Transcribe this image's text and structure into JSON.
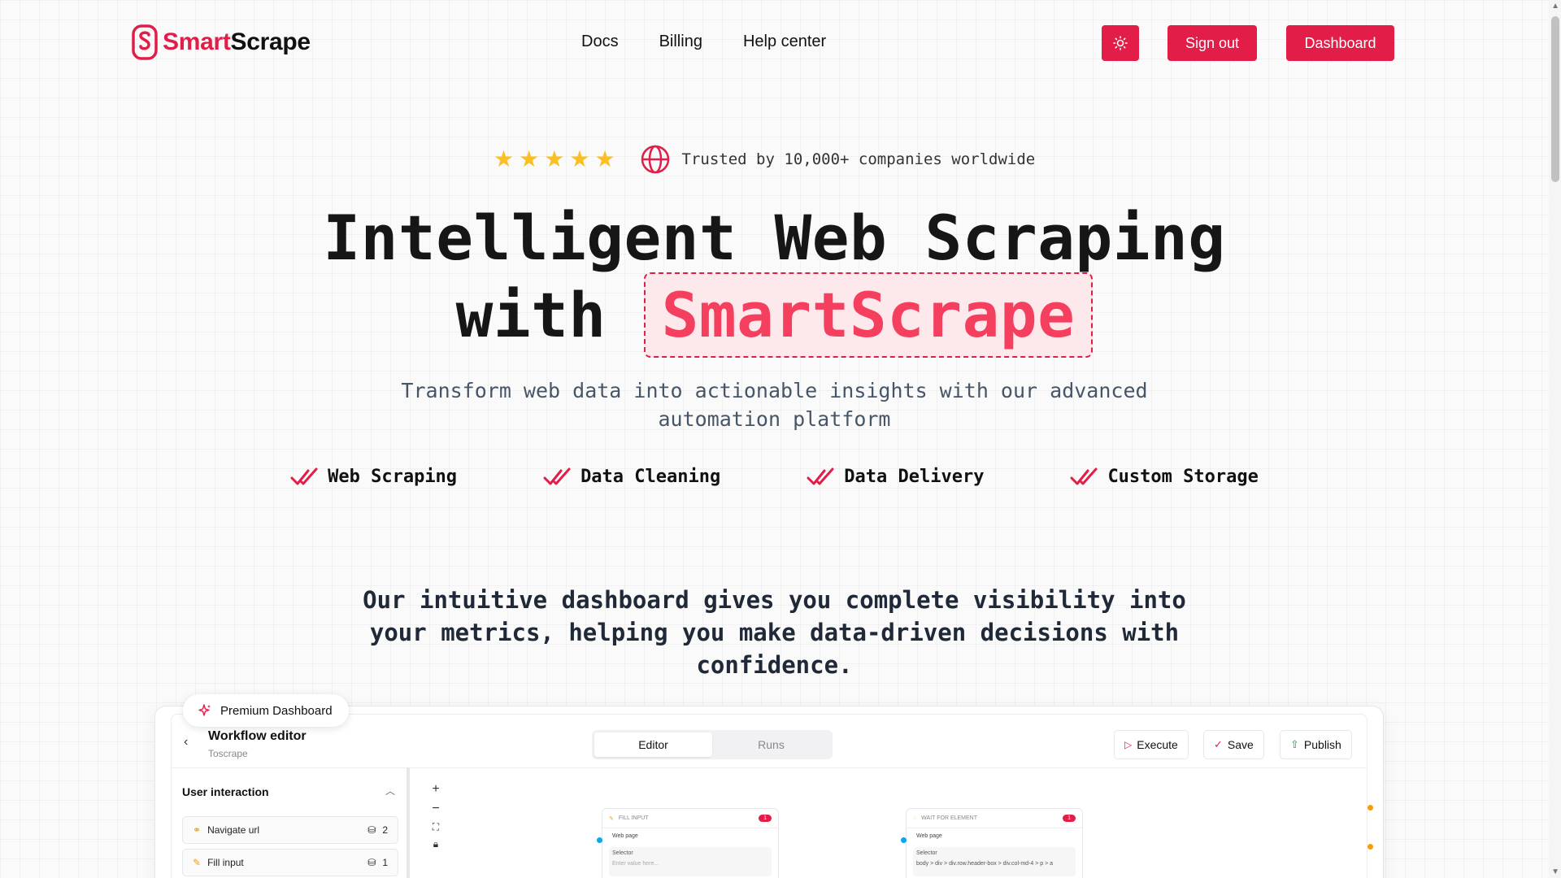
{
  "brand": {
    "name_part1": "Smart",
    "name_part2": "Scrape",
    "accent": "#e11d48"
  },
  "nav": {
    "links": [
      "Docs",
      "Billing",
      "Help center"
    ],
    "theme_icon": "sun-icon",
    "sign_out": "Sign out",
    "dashboard": "Dashboard"
  },
  "trust": {
    "stars": 5,
    "text": "Trusted by 10,000+ companies worldwide"
  },
  "hero": {
    "line1": "Intelligent Web Scraping",
    "line2_prefix": "with",
    "highlight": "SmartScrape",
    "subtitle_line1": "Transform web data into actionable insights with our advanced",
    "subtitle_line2": "automation platform"
  },
  "features": [
    "Web Scraping",
    "Data Cleaning",
    "Data Delivery",
    "Custom Storage"
  ],
  "lead": {
    "line1": "Our intuitive dashboard gives you complete visibility into",
    "line2": "your metrics, helping you make data-driven decisions with",
    "line3": "confidence."
  },
  "preview": {
    "badge": "Premium Dashboard",
    "title": "Workflow editor",
    "subtitle": "Toscrape",
    "tabs": [
      "Editor",
      "Runs"
    ],
    "actions": {
      "execute": "Execute",
      "save": "Save",
      "publish": "Publish"
    },
    "section": "User interaction",
    "tasks": [
      {
        "label": "Navigate url",
        "count": "2"
      },
      {
        "label": "Fill input",
        "count": "1"
      }
    ],
    "nodes": [
      {
        "title": "FILL INPUT",
        "badge": "1",
        "row": "Web page",
        "selector_label": "Selector",
        "value": "Enter value here..."
      },
      {
        "title": "WAIT FOR ELEMENT",
        "badge": "1",
        "row": "Web page",
        "selector_label": "Selector",
        "value": "body > div > div.row.header-box > div.col-md-4 > p > a"
      }
    ]
  }
}
